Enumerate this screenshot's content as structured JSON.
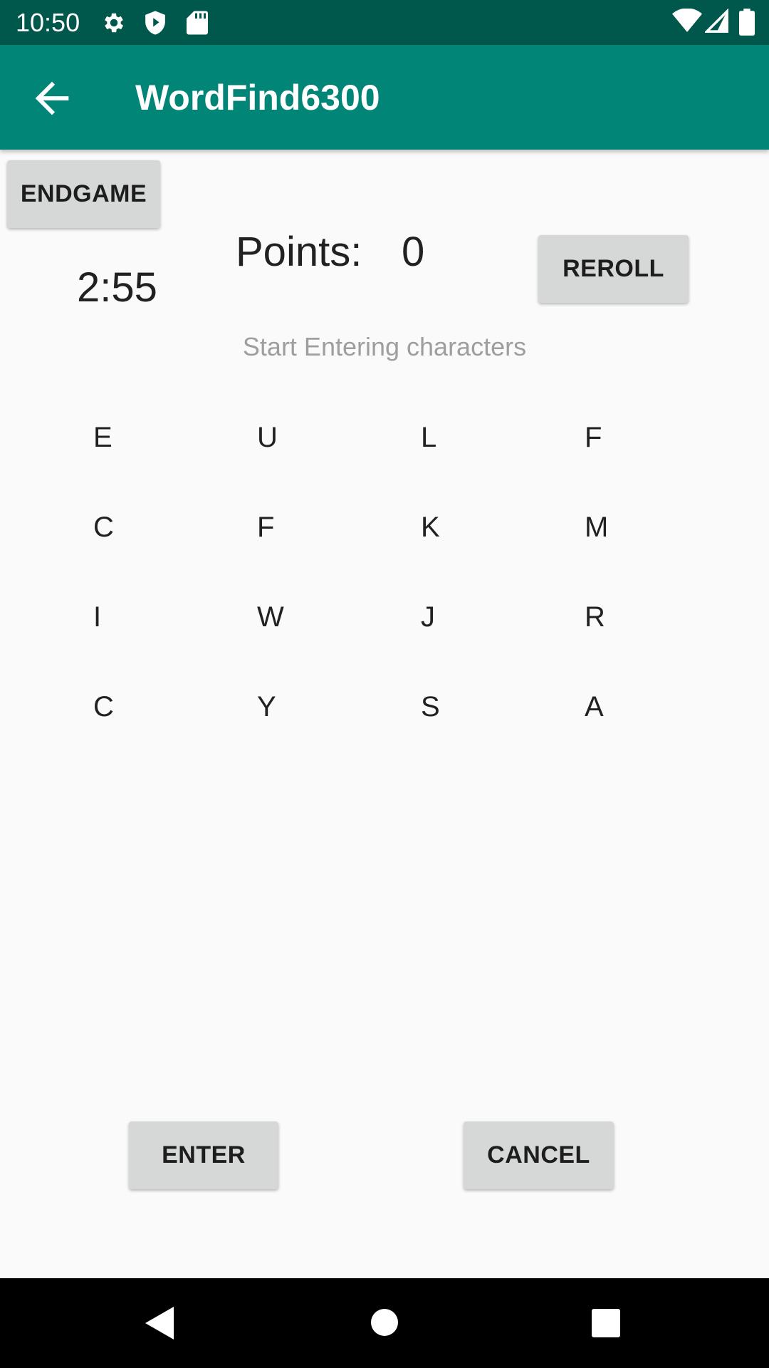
{
  "status_bar": {
    "time": "10:50",
    "left_icons": [
      "gear-icon",
      "shield-icon",
      "sd-card-icon"
    ],
    "right_icons": [
      "wifi-icon",
      "cell-signal-icon",
      "battery-icon"
    ]
  },
  "app_bar": {
    "title": "WordFind6300",
    "back_icon": "arrow-left-icon"
  },
  "controls": {
    "endgame_label": "ENDGAME",
    "reroll_label": "REROLL",
    "enter_label": "ENTER",
    "cancel_label": "CANCEL"
  },
  "game": {
    "timer": "2:55",
    "points_label": "Points:",
    "points_value": "0",
    "entry_hint": "Start Entering characters",
    "grid": [
      [
        "E",
        "U",
        "L",
        "F"
      ],
      [
        "C",
        "F",
        "K",
        "M"
      ],
      [
        "I",
        "W",
        "J",
        "R"
      ],
      [
        "C",
        "Y",
        "S",
        "A"
      ]
    ]
  },
  "nav_bar": {
    "icons": [
      "back-triangle-icon",
      "home-circle-icon",
      "recents-square-icon"
    ]
  },
  "colors": {
    "status_bar": "#00574b",
    "app_bar": "#008577",
    "button": "#d6d7d7",
    "background": "#fafafa",
    "hint_text": "#9e9e9e"
  }
}
